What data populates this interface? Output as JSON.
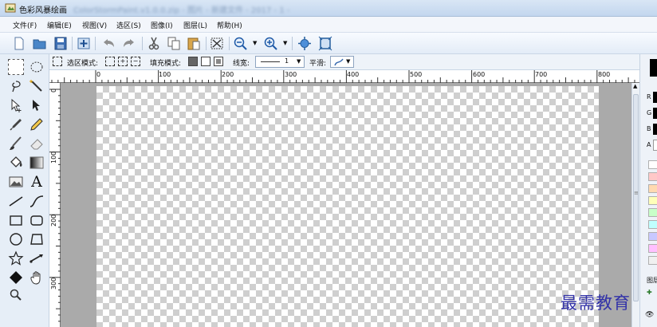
{
  "window": {
    "title": "色彩风暴绘画",
    "document_name_blurred": "ColorStormPaint.v1.0.0.zip - 图片 - 新建文件 - 2017 - 1 -"
  },
  "menubar": {
    "items": [
      "文件(F)",
      "编辑(E)",
      "视图(V)",
      "选区(S)",
      "图像(I)",
      "图层(L)",
      "帮助(H)"
    ]
  },
  "toolbar": {
    "buttons": [
      "new-file",
      "open-folder",
      "save",
      "add",
      "undo",
      "redo",
      "cut",
      "copy",
      "paste",
      "crop",
      "zoom-out",
      "zoom-in",
      "pan",
      "fit"
    ]
  },
  "options": {
    "select_mode_label": "选区模式:",
    "fill_mode_label": "填充模式:",
    "line_width_label": "线宽:",
    "line_width_value": "1",
    "smooth_label": "平滑:"
  },
  "ruler": {
    "horizontal_labels": [
      "0",
      "100",
      "200",
      "300",
      "400",
      "500",
      "600",
      "700",
      "800"
    ],
    "vertical_labels": [
      "0",
      "100",
      "200",
      "300"
    ]
  },
  "right_panel": {
    "channels": [
      "R",
      "G",
      "B",
      "A"
    ],
    "swatch_colors": [
      "#ffffff",
      "#ffc8c8",
      "#ffd9b0",
      "#ffffb8",
      "#c8ffc8",
      "#c0ffff",
      "#c8c8ff",
      "#ffc0ff",
      "#f0f0f0"
    ],
    "layer_label": "图层"
  },
  "watermark": "最需教育"
}
